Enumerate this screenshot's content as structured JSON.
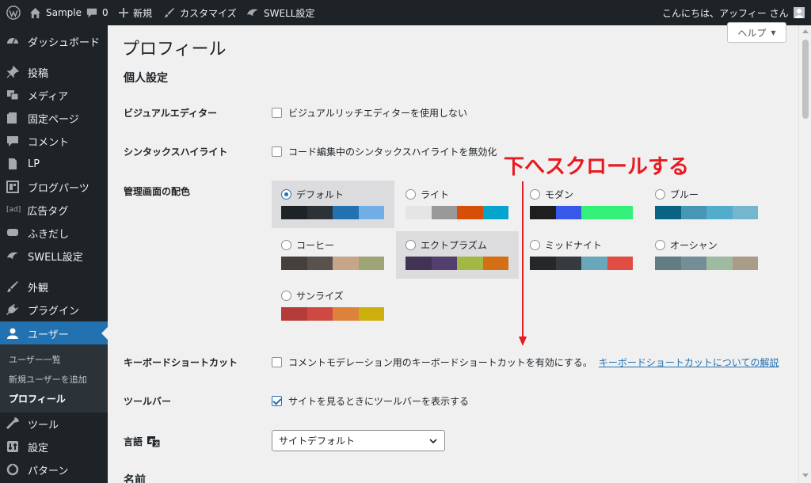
{
  "adminbar": {
    "site_name": "Sample",
    "comments_count": "0",
    "new_label": "新規",
    "customize_label": "カスタマイズ",
    "swell_label": "SWELL設定",
    "greeting": "こんにちは、アッフィー さん"
  },
  "sidebar": {
    "items": [
      {
        "label": "ダッシュボード",
        "icon": "dashboard-icon"
      },
      {
        "label": "投稿",
        "icon": "pin-icon"
      },
      {
        "label": "メディア",
        "icon": "media-icon"
      },
      {
        "label": "固定ページ",
        "icon": "page-icon"
      },
      {
        "label": "コメント",
        "icon": "comment-icon"
      },
      {
        "label": "LP",
        "icon": "document-icon"
      },
      {
        "label": "ブログパーツ",
        "icon": "layout-icon"
      },
      {
        "label": "広告タグ",
        "icon": "ad-icon"
      },
      {
        "label": "ふきだし",
        "icon": "speech-bubble-icon"
      },
      {
        "label": "SWELL設定",
        "icon": "swell-icon"
      },
      {
        "label": "外観",
        "icon": "appearance-icon"
      },
      {
        "label": "プラグイン",
        "icon": "plugin-icon"
      },
      {
        "label": "ユーザー",
        "icon": "user-icon"
      },
      {
        "label": "ツール",
        "icon": "wrench-icon"
      },
      {
        "label": "設定",
        "icon": "settings-icon"
      },
      {
        "label": "パターン",
        "icon": "pattern-icon"
      }
    ],
    "submenu": [
      "ユーザー一覧",
      "新規ユーザーを追加",
      "プロフィール"
    ]
  },
  "main": {
    "help_label": "ヘルプ",
    "title": "プロフィール",
    "section_personal": "個人設定",
    "visual_editor": {
      "label": "ビジュアルエディター",
      "option": "ビジュアルリッチエディターを使用しない",
      "checked": false
    },
    "syntax": {
      "label": "シンタックスハイライト",
      "option": "コード編集中のシンタックスハイライトを無効化",
      "checked": false
    },
    "color_scheme_label": "管理画面の配色",
    "schemes": [
      {
        "name": "デフォルト",
        "selected": true,
        "colors": [
          "#1d2327",
          "#2c3338",
          "#2271b1",
          "#72aee6"
        ]
      },
      {
        "name": "ライト",
        "selected": false,
        "colors": [
          "#e5e5e5",
          "#999999",
          "#d64e07",
          "#04a4cc"
        ]
      },
      {
        "name": "モダン",
        "selected": false,
        "colors": [
          "#1e1e1e",
          "#3858e9",
          "#33f078",
          "#33f078"
        ]
      },
      {
        "name": "ブルー",
        "selected": false,
        "colors": [
          "#096484",
          "#4796b3",
          "#52accc",
          "#74b6ce"
        ]
      },
      {
        "name": "コーヒー",
        "selected": false,
        "colors": [
          "#46403c",
          "#59524c",
          "#c7a589",
          "#9ea476"
        ]
      },
      {
        "name": "エクトプラズム",
        "selected": false,
        "colors": [
          "#413256",
          "#523f6d",
          "#a3b745",
          "#d46f15"
        ]
      },
      {
        "name": "ミッドナイト",
        "selected": false,
        "colors": [
          "#25282b",
          "#363b3f",
          "#69a8bb",
          "#e14d43"
        ]
      },
      {
        "name": "オーシャン",
        "selected": false,
        "colors": [
          "#627c83",
          "#738e96",
          "#9ebaa0",
          "#aa9d88"
        ]
      },
      {
        "name": "サンライズ",
        "selected": false,
        "colors": [
          "#b43c38",
          "#cf4944",
          "#dd823b",
          "#ccaf0b"
        ]
      }
    ],
    "keyboard": {
      "label": "キーボードショートカット",
      "option": "コメントモデレーション用のキーボードショートカットを有効にする。",
      "link": "キーボードショートカットについての解説",
      "checked": false
    },
    "toolbar": {
      "label": "ツールバー",
      "option": "サイトを見るときにツールバーを表示する",
      "checked": true
    },
    "language": {
      "label": "言語",
      "value": "サイトデフォルト"
    },
    "name_heading": "名前"
  },
  "annotation": {
    "text": "下へスクロールする",
    "color": "#e8191f"
  }
}
